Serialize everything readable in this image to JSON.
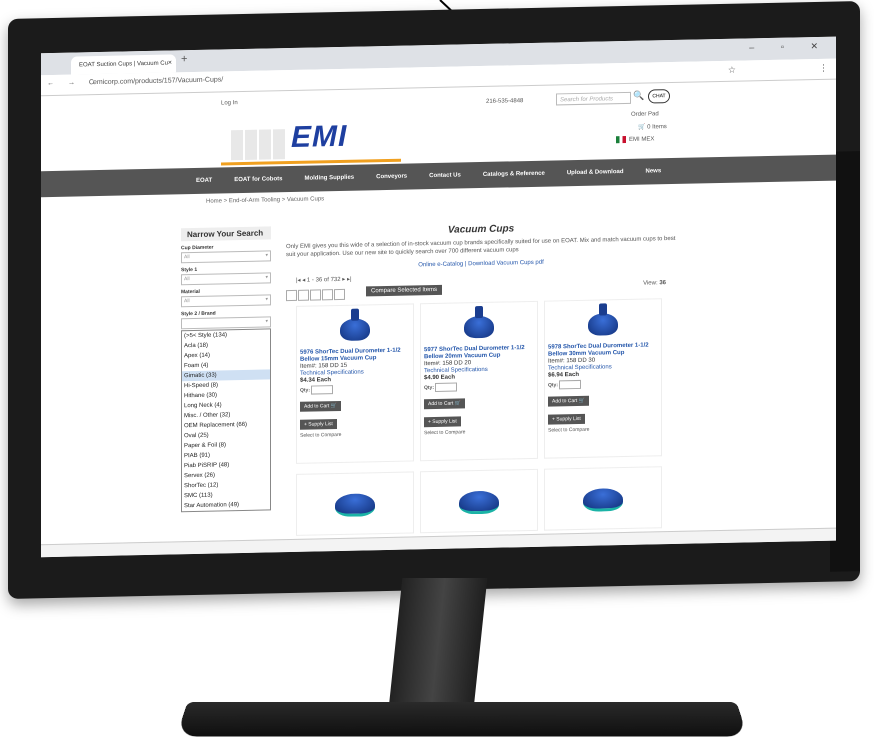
{
  "browser": {
    "tab_title": "EOAT Suction Cups | Vacuum Cu",
    "tab_close": "×",
    "new_tab": "+",
    "window_controls": "–  ▫  ✕",
    "nav": "← → C",
    "url": "emicorp.com/products/157/Vacuum-Cups/",
    "star": "☆",
    "menu": "⋮"
  },
  "header": {
    "login": "Log In",
    "phone": "216-535-4848",
    "search_placeholder": "Search for Products",
    "search_icon": "🔍",
    "chat": "CHAT",
    "order_pad": "Order Pad",
    "items": "🛒 0 Items",
    "emi_mex": "EMI MEX",
    "logo": "EMI"
  },
  "nav": {
    "items": [
      "EOAT",
      "EOAT for Cobots",
      "Molding Supplies",
      "Conveyors",
      "Contact Us",
      "Catalogs & Reference",
      "Upload & Download",
      "News"
    ]
  },
  "breadcrumb": "Home > End-of-Arm Tooling > Vacuum Cups",
  "sidebar": {
    "title": "Narrow Your Search",
    "filters": [
      {
        "label": "Cup Diameter",
        "value": "All"
      },
      {
        "label": "Style 1",
        "value": "All"
      },
      {
        "label": "Material",
        "value": "All"
      },
      {
        "label": "Style 2 / Brand",
        "value": ""
      }
    ],
    "list": [
      "(>5< Style (134)",
      "Acla (18)",
      "Apex (14)",
      "Foam (4)",
      "Gimatic (33)",
      "Hi-Speed (8)",
      "Hithane (30)",
      "Long Neck (4)",
      "Misc. / Other (32)",
      "OEM Replacement (66)",
      "Oval (25)",
      "Paper & Foil (8)",
      "PIAB (91)",
      "Piab PiSRIP (48)",
      "Servex (26)",
      "ShorTec (12)",
      "SMC (113)",
      "Star Automation (49)"
    ],
    "highlighted_index": 4
  },
  "main": {
    "title": "Vacuum Cups",
    "intro": "Only EMI gives you this wide of a selection of in-stock vacuum cup brands specifically suited for use on EOAT. Mix and match vacuum cups to best suit your application. Use our new site to quickly search over 700 different vacuum cups",
    "links": "Online e-Catalog | Download Vacuum Cups pdf",
    "pager": "|◂  ◂  1 - 36 of 732  ▸  ▸|",
    "compare_btn": "Compare Selected Items",
    "view_label": "View:",
    "view_value": "36"
  },
  "products": [
    {
      "title": "5976 ShorTec Dual Durometer 1-1/2 Bellow 15mm Vacuum Cup",
      "item": "Item#: 158 DD 15",
      "spec": "Technical Specifications",
      "price": "$4.34 Each",
      "qty": "Qty:",
      "add": "Add to Cart 🛒",
      "supply": "+ Supply List",
      "compare": "Select to Compare"
    },
    {
      "title": "5977 ShorTec Dual Durometer 1-1/2 Bellow 20mm Vacuum Cup",
      "item": "Item#: 158 DD 20",
      "spec": "Technical Specifications",
      "price": "$4.90 Each",
      "qty": "Qty:",
      "add": "Add to Cart 🛒",
      "supply": "+ Supply List",
      "compare": "Select to Compare"
    },
    {
      "title": "5978 ShorTec Dual Durometer 1-1/2 Bellow 30mm Vacuum Cup",
      "item": "Item#: 158 DD 30",
      "spec": "Technical Specifications",
      "price": "$6.94 Each",
      "qty": "Qty:",
      "add": "Add to Cart 🛒",
      "supply": "+ Supply List",
      "compare": "Select to Compare"
    }
  ],
  "colors": {
    "accent": "#1e3fa0",
    "nav_bg": "#555555",
    "link": "#2255aa"
  }
}
